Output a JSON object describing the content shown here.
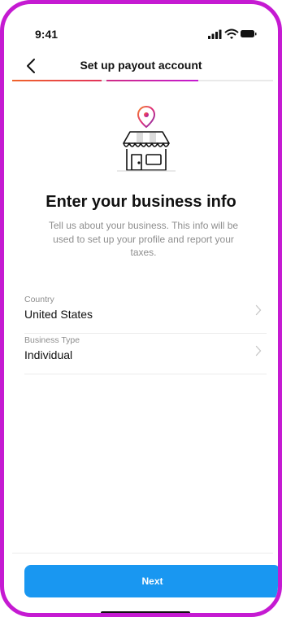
{
  "status_bar": {
    "time": "9:41",
    "icons": [
      "signal-icon",
      "wifi-icon",
      "battery-icon"
    ]
  },
  "header": {
    "title": "Set up payout account",
    "back_icon": "chevron-left-icon"
  },
  "progress": {
    "total_steps": 3,
    "current_step": 2
  },
  "content": {
    "illustration": "storefront-with-location-pin",
    "heading": "Enter your business info",
    "description_lines": [
      "Tell us about your business. This info will be",
      "used to set up your profile and report your",
      "taxes."
    ]
  },
  "form": {
    "rows": [
      {
        "label": "Country",
        "value": "United States"
      },
      {
        "label": "Business Type",
        "value": "Individual"
      }
    ]
  },
  "footer": {
    "next_label": "Next"
  },
  "colors": {
    "frame": "#c51ad2",
    "primary_button": "#1997f1",
    "secondary_text": "#8e8e8e",
    "pin_gradient": [
      "#f58529",
      "#dd2a7b",
      "#8134af"
    ]
  }
}
